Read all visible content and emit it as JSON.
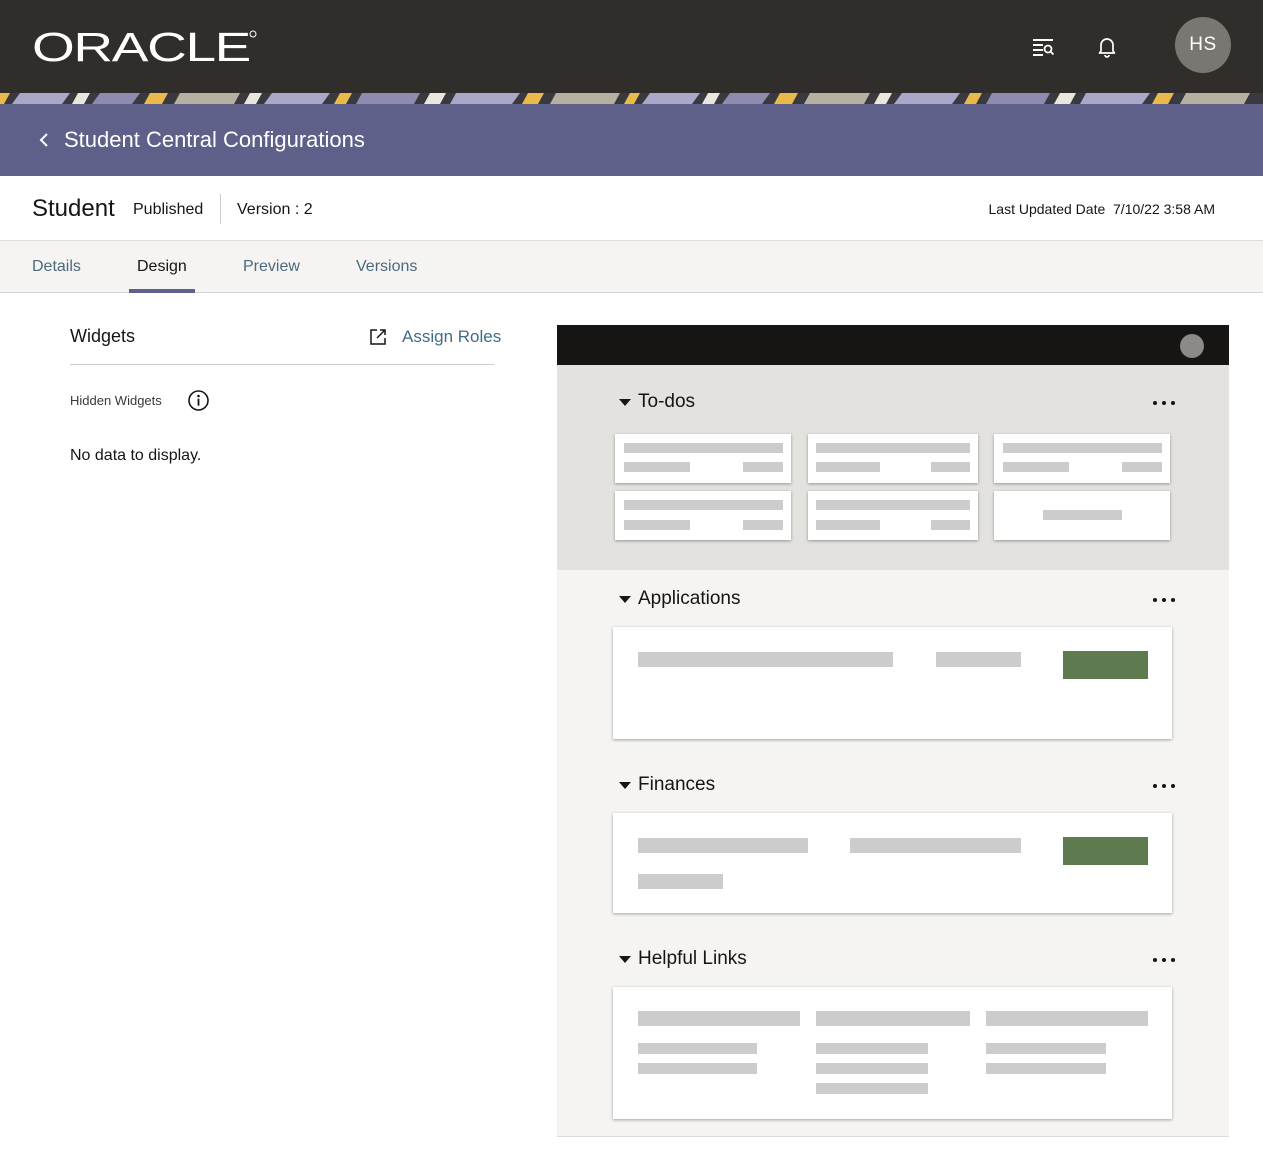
{
  "header": {
    "logo_text": "ORACLE",
    "icons": [
      "search-list-icon",
      "bell-icon"
    ],
    "avatar_initials": "HS"
  },
  "banner": {
    "title": "Student Central Configurations",
    "back_icon": "chevron-left-icon"
  },
  "info": {
    "name": "Student",
    "status": "Published",
    "version": "Version : 2",
    "last_updated": "Last Updated Date  7/10/22 3:58 AM"
  },
  "tabs": [
    {
      "label": "Details"
    },
    {
      "label": "Design",
      "active": true
    },
    {
      "label": "Preview"
    },
    {
      "label": "Versions"
    }
  ],
  "left": {
    "title": "Widgets",
    "assign_roles": "Assign Roles",
    "hidden_widgets": "Hidden Widgets",
    "no_data": "No data to display."
  },
  "preview": {
    "sections": [
      {
        "title": "To-dos"
      },
      {
        "title": "Applications"
      },
      {
        "title": "Finances"
      },
      {
        "title": "Helpful Links"
      }
    ]
  },
  "colors": {
    "header_bg": "#312d2a",
    "banner_bg": "#5f6089",
    "link": "#3f6d8a",
    "accent_green": "#5d7b4f"
  }
}
